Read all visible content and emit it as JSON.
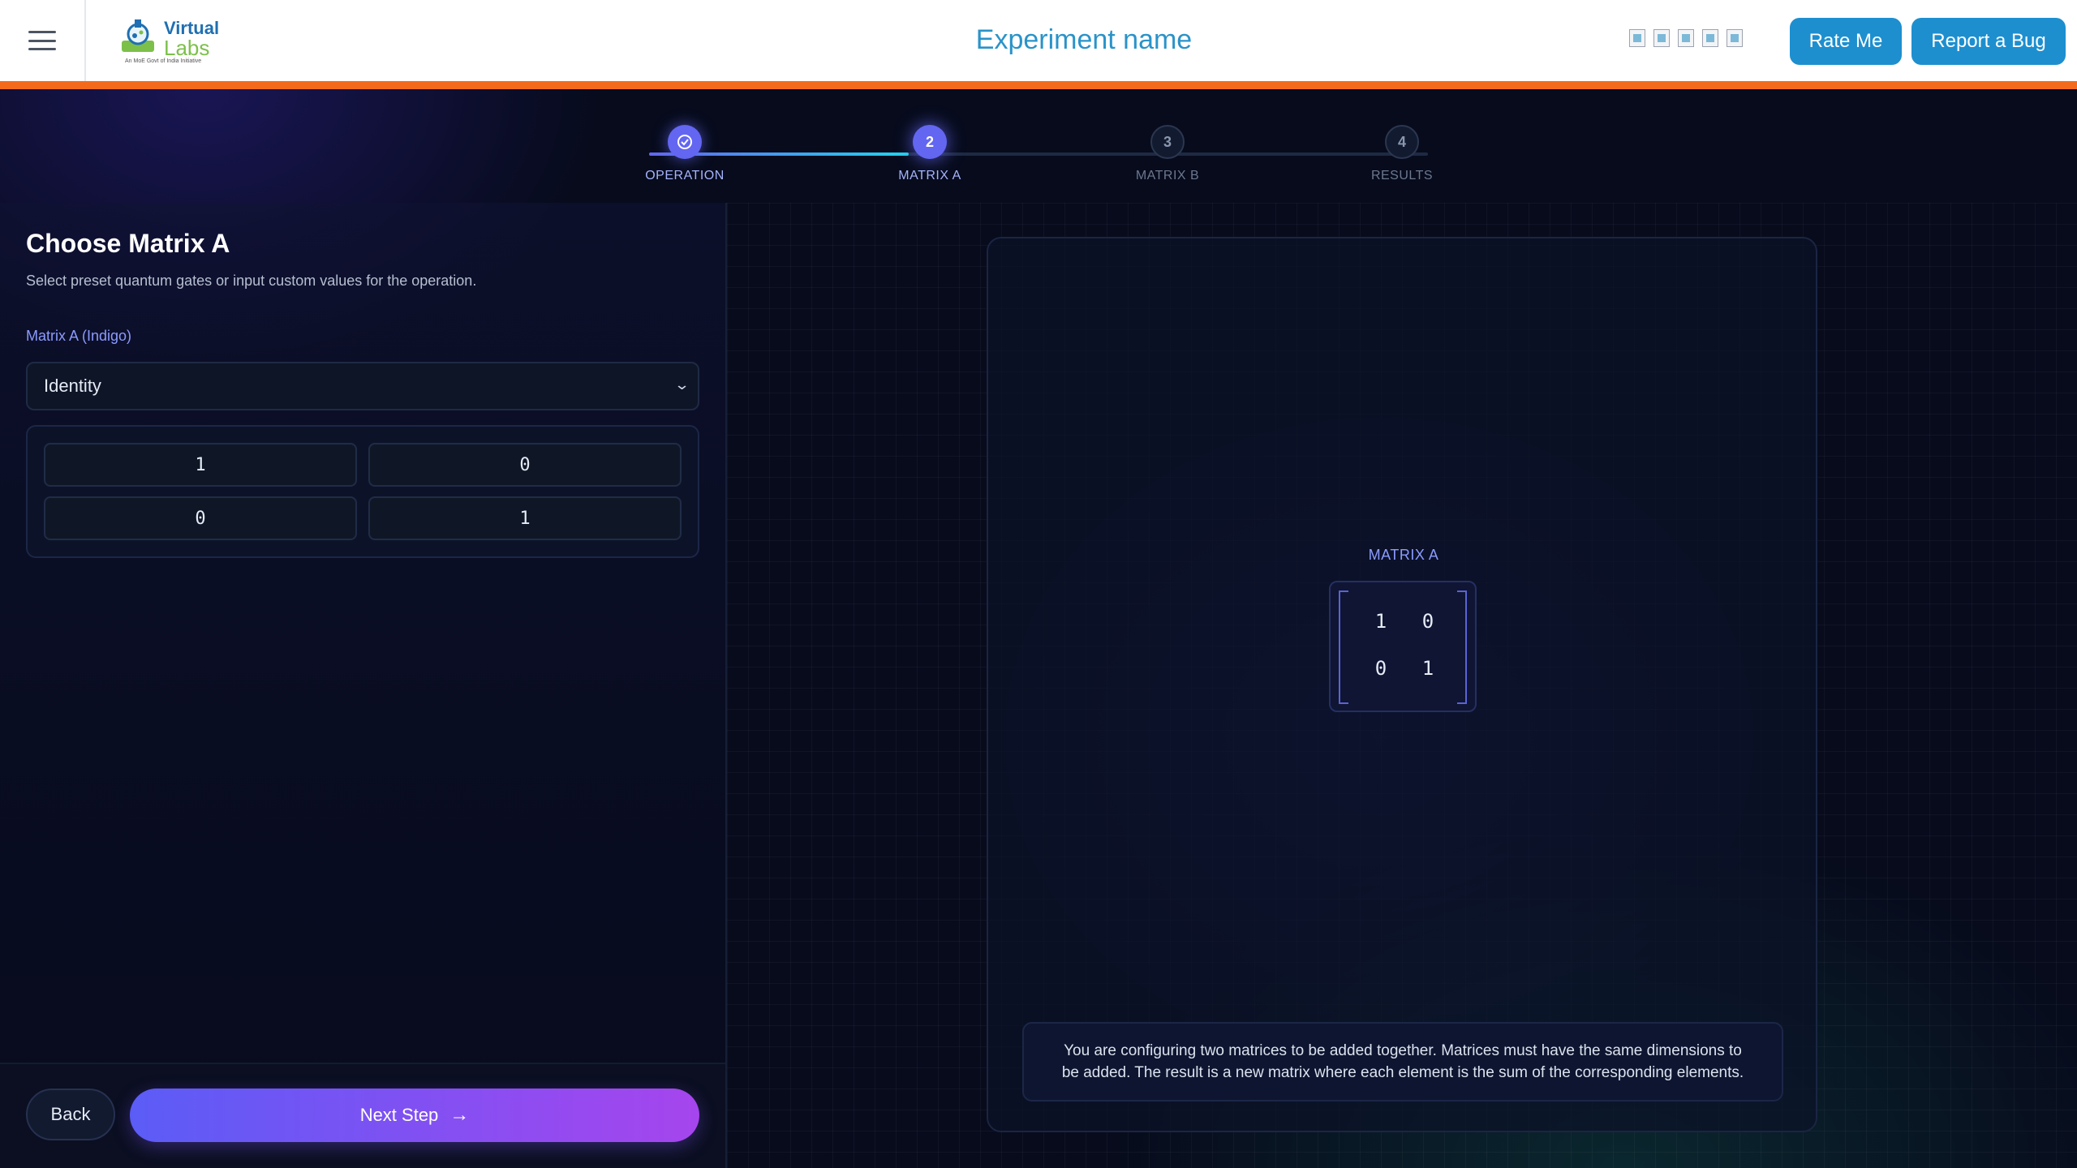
{
  "header": {
    "logo_line1": "Virtual",
    "logo_line2": "Labs",
    "logo_tagline": "An MoE Govt of India Initiative",
    "title": "Experiment name",
    "rate_label": "Rate Me",
    "bug_label": "Report a Bug",
    "social_icons": [
      "social-icon-1",
      "social-icon-2",
      "social-icon-3",
      "social-icon-4",
      "social-icon-5"
    ]
  },
  "stepper": {
    "steps": [
      {
        "number": "",
        "label": "OPERATION",
        "state": "done"
      },
      {
        "number": "2",
        "label": "MATRIX A",
        "state": "active"
      },
      {
        "number": "3",
        "label": "MATRIX B",
        "state": "todo"
      },
      {
        "number": "4",
        "label": "RESULTS",
        "state": "todo"
      }
    ]
  },
  "left_panel": {
    "title": "Choose Matrix A",
    "subtitle": "Select preset quantum gates or input custom values for the operation.",
    "field_label": "Matrix A (Indigo)",
    "select_value": "Identity",
    "matrix": [
      [
        "1",
        "0"
      ],
      [
        "0",
        "1"
      ]
    ],
    "back_label": "Back",
    "next_label": "Next Step"
  },
  "preview": {
    "caption": "MATRIX A",
    "matrix": [
      [
        "1",
        "0"
      ],
      [
        "0",
        "1"
      ]
    ],
    "info": "You are configuring two matrices to be added together. Matrices must have the same dimensions to be added. The result is a new matrix where each element is the sum of the corresponding elements."
  },
  "colors": {
    "accent": "#6366f1",
    "header_blue": "#1d8fcf",
    "orange_line": "#f46a1c",
    "next_gradient_end": "#a645ee"
  }
}
